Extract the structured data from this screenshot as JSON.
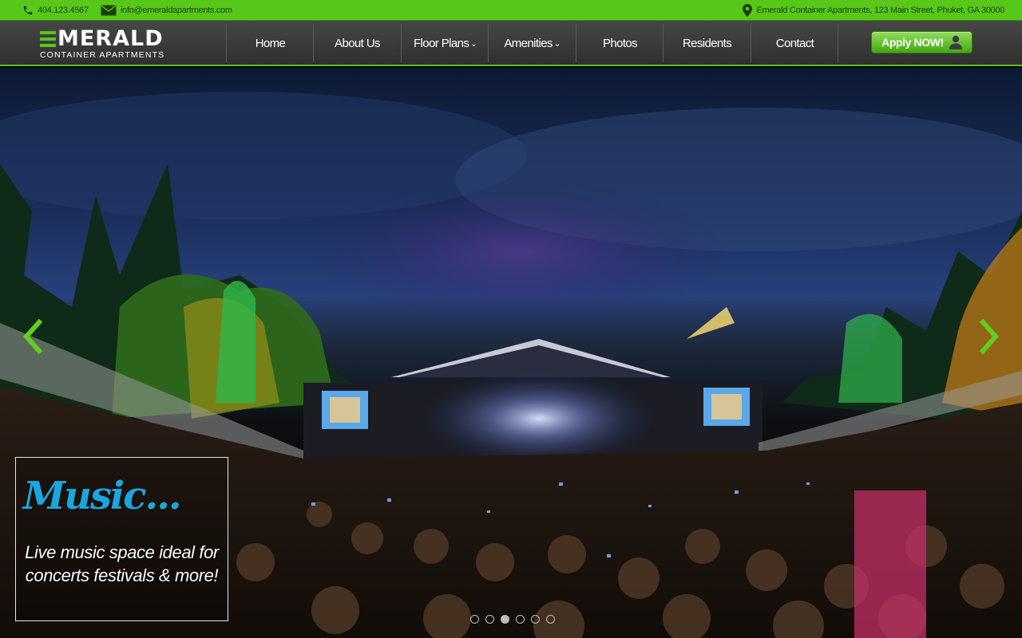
{
  "topbar": {
    "phone": "404.123.4567",
    "email": "info@emeraldapartments.com",
    "address": "Emerald Container Apartments, 123 Main Street, Phuket, GA 30000"
  },
  "logo": {
    "word": "MERALD",
    "subtitle": "CONTAINER APARTMENTS"
  },
  "nav": {
    "items": [
      {
        "label": "Home",
        "has_dropdown": false
      },
      {
        "label": "About Us",
        "has_dropdown": false
      },
      {
        "label": "Floor Plans",
        "has_dropdown": true
      },
      {
        "label": "Amenities",
        "has_dropdown": true
      },
      {
        "label": "Photos",
        "has_dropdown": false
      },
      {
        "label": "Residents",
        "has_dropdown": false
      },
      {
        "label": "Contact",
        "has_dropdown": false
      }
    ],
    "cta": "Apply NOW!"
  },
  "hero": {
    "caption_title": "Music...",
    "caption_text": "Live music space ideal for concerts festivals & more!",
    "slide_count": 6,
    "active_slide": 3
  },
  "colors": {
    "brand_green": "#57c81a",
    "caption_blue": "#1aa6dc",
    "nav_bg": "#3a3a3a"
  },
  "icons": {
    "phone": "phone-icon",
    "email": "envelope-icon",
    "address": "map-pin-icon",
    "apply": "user-icon",
    "prev": "chevron-left-icon",
    "next": "chevron-right-icon"
  }
}
